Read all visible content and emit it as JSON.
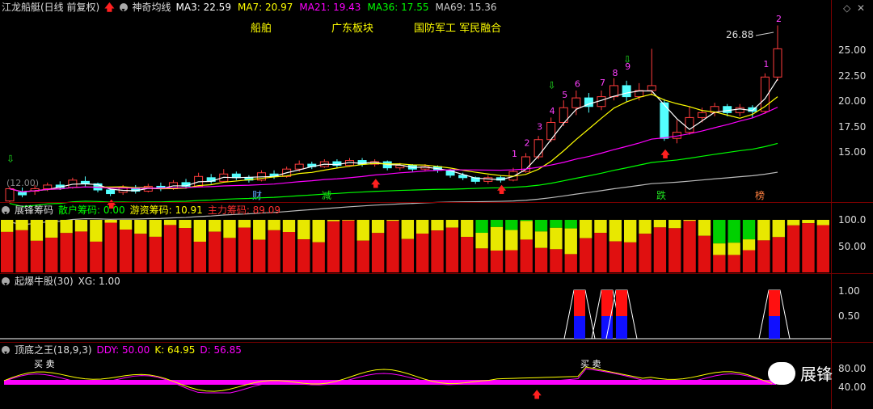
{
  "main": {
    "title": "江龙船艇(日线 前复权)",
    "indicator": "神奇均线",
    "ma": [
      {
        "label": "MA3: 22.59",
        "color": "#ffffff"
      },
      {
        "label": "MA7: 20.97",
        "color": "#ffff00"
      },
      {
        "label": "MA21: 19.43",
        "color": "#ff00ff"
      },
      {
        "label": "MA36: 17.55",
        "color": "#00ff00"
      },
      {
        "label": "MA69: 15.36",
        "color": "#cccccc"
      }
    ],
    "tags": [
      "船舶",
      "广东板块",
      "国防军工 军民融合"
    ],
    "price_note": "26.88",
    "left_note": "(12.00)",
    "yaxis": [
      "25.00",
      "22.50",
      "20.00",
      "17.50",
      "15.00"
    ],
    "events": [
      {
        "label": "财",
        "color": "#5fa8ff"
      },
      {
        "label": "减",
        "color": "#20e020"
      },
      {
        "label": "跌",
        "color": "#20e020"
      },
      {
        "label": "榜",
        "color": "#ff8040"
      }
    ],
    "counts": [
      "1",
      "2",
      "3",
      "4",
      "5",
      "6",
      "7",
      "8",
      "9",
      "1",
      "2"
    ]
  },
  "chip": {
    "title": "展锋筹码",
    "fields": [
      {
        "label": "散户筹码: 0.00",
        "color": "#00ff00"
      },
      {
        "label": "游资筹码: 10.91",
        "color": "#ffff00"
      },
      {
        "label": "主力筹码: 89.09",
        "color": "#ff3030"
      }
    ],
    "yaxis": [
      "100.0",
      "50.00"
    ]
  },
  "qb": {
    "title": "起爆牛股(30)",
    "field": "XG: 1.00",
    "yaxis": [
      "1.00",
      "0.50"
    ]
  },
  "dd": {
    "title": "顶底之王(18,9,3)",
    "fields": [
      {
        "label": "DDY: 50.00",
        "color": "#ff00ff"
      },
      {
        "label": "K: 64.95",
        "color": "#ffff00"
      },
      {
        "label": "D: 56.85",
        "color": "#ff00ff"
      }
    ],
    "signal": "买 卖",
    "yaxis": [
      "80.00",
      "40.00"
    ]
  },
  "watermark": "展锋",
  "chart_data": {
    "type": "candlestick",
    "ylim": [
      13.5,
      27
    ],
    "candles": [
      [
        12.6,
        13.6,
        12.4,
        13.8
      ],
      [
        13.3,
        13.1,
        12.9,
        13.7
      ],
      [
        13.4,
        13.6,
        13.1,
        13.9
      ],
      [
        13.6,
        13.9,
        13.4,
        14.1
      ],
      [
        13.9,
        13.7,
        13.5,
        14.2
      ],
      [
        13.7,
        14.3,
        13.6,
        14.5
      ],
      [
        14.2,
        14.0,
        13.8,
        14.6
      ],
      [
        14.0,
        13.5,
        13.3,
        14.1
      ],
      [
        13.5,
        13.2,
        13.0,
        13.7
      ],
      [
        13.3,
        13.7,
        13.1,
        13.9
      ],
      [
        13.7,
        13.4,
        13.2,
        13.9
      ],
      [
        13.4,
        13.8,
        13.3,
        14.0
      ],
      [
        13.8,
        13.6,
        13.4,
        14.1
      ],
      [
        13.6,
        14.1,
        13.5,
        14.3
      ],
      [
        14.1,
        13.8,
        13.6,
        14.4
      ],
      [
        13.8,
        14.6,
        13.7,
        14.9
      ],
      [
        14.5,
        14.2,
        14.0,
        14.8
      ],
      [
        14.2,
        14.8,
        14.1,
        15.2
      ],
      [
        14.8,
        14.5,
        14.3,
        15.0
      ],
      [
        14.5,
        14.3,
        14.1,
        14.7
      ],
      [
        14.3,
        14.9,
        14.2,
        15.1
      ],
      [
        14.8,
        14.6,
        14.4,
        15.1
      ],
      [
        14.6,
        15.2,
        14.5,
        15.4
      ],
      [
        15.2,
        15.6,
        15.0,
        15.9
      ],
      [
        15.6,
        15.4,
        15.2,
        15.8
      ],
      [
        15.4,
        15.8,
        15.3,
        16.0
      ],
      [
        15.8,
        15.5,
        15.3,
        16.0
      ],
      [
        15.5,
        15.9,
        15.4,
        16.1
      ],
      [
        15.9,
        15.6,
        15.4,
        16.1
      ],
      [
        15.6,
        15.8,
        15.4,
        16.0
      ],
      [
        15.8,
        15.3,
        15.1,
        15.9
      ],
      [
        15.3,
        15.5,
        15.1,
        15.7
      ],
      [
        15.5,
        15.2,
        15.0,
        15.6
      ],
      [
        15.2,
        15.4,
        15.0,
        15.6
      ],
      [
        15.4,
        15.1,
        14.9,
        15.5
      ],
      [
        15.1,
        14.7,
        14.5,
        15.2
      ],
      [
        14.7,
        14.5,
        14.3,
        14.9
      ],
      [
        14.5,
        14.2,
        14.0,
        14.6
      ],
      [
        14.2,
        14.5,
        14.0,
        14.7
      ],
      [
        14.5,
        14.3,
        14.1,
        14.7
      ],
      [
        14.3,
        15.0,
        14.2,
        15.3
      ],
      [
        15.0,
        16.2,
        14.9,
        16.5
      ],
      [
        16.2,
        17.6,
        16.0,
        17.9
      ],
      [
        17.6,
        19.0,
        17.4,
        19.4
      ],
      [
        19.0,
        20.2,
        18.7,
        20.8
      ],
      [
        20.2,
        21.0,
        19.6,
        21.6
      ],
      [
        21.0,
        20.3,
        19.8,
        21.4
      ],
      [
        20.3,
        21.1,
        20.0,
        21.6
      ],
      [
        21.1,
        22.0,
        20.8,
        22.6
      ],
      [
        22.0,
        21.1,
        20.7,
        22.4
      ],
      [
        21.1,
        21.6,
        20.8,
        22.2
      ],
      [
        21.6,
        22.0,
        21.2,
        25.0
      ],
      [
        20.6,
        17.7,
        17.5,
        20.9
      ],
      [
        17.7,
        18.2,
        17.3,
        19.2
      ],
      [
        18.2,
        19.4,
        18.0,
        20.3
      ],
      [
        19.4,
        19.8,
        19.0,
        20.2
      ],
      [
        19.8,
        20.3,
        19.5,
        20.6
      ],
      [
        20.3,
        19.8,
        19.5,
        20.5
      ],
      [
        19.8,
        20.2,
        19.5,
        20.5
      ],
      [
        20.2,
        19.9,
        19.4,
        20.4
      ],
      [
        19.9,
        22.7,
        19.7,
        23.0
      ],
      [
        22.7,
        25.0,
        22.4,
        26.9
      ]
    ]
  }
}
